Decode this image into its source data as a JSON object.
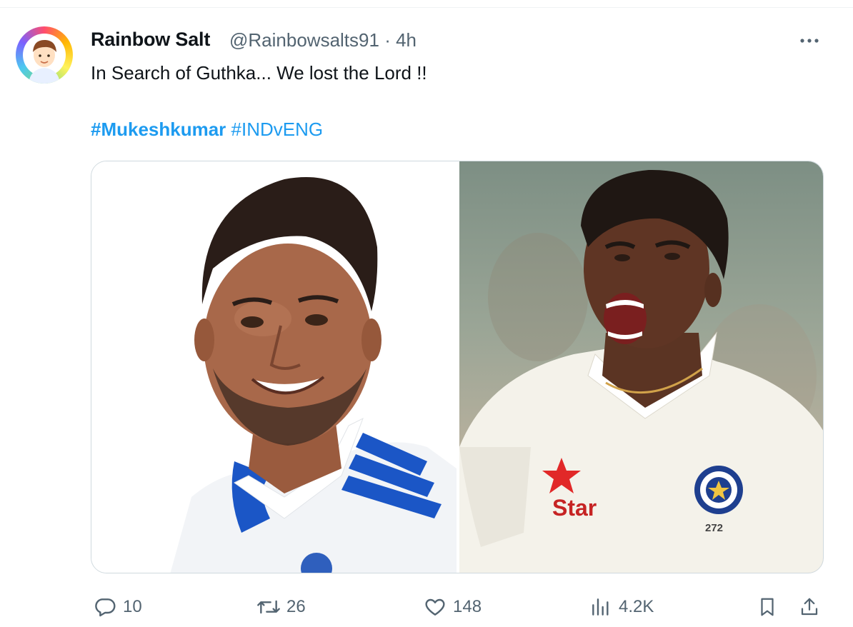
{
  "tweet": {
    "display_name": "Rainbow Salt",
    "handle": "@Rainbowsalts91",
    "separator": "·",
    "time": "4h",
    "text": "In Search of Guthka... We lost the Lord !!",
    "hashtags": [
      "#Mukeshkumar",
      "#INDvENG"
    ]
  },
  "media": {
    "right_image": {
      "sponsor_text": "Star",
      "shirt_number": "272"
    }
  },
  "actions": {
    "reply_count": "10",
    "retweet_count": "26",
    "like_count": "148",
    "view_count": "4.2K"
  },
  "icons": {
    "reply": "speech-bubble-icon",
    "retweet": "retweet-arrows-icon",
    "like": "heart-icon",
    "views": "bar-chart-icon",
    "bookmark": "bookmark-icon",
    "share": "share-upload-icon",
    "more": "three-dots-icon"
  },
  "colors": {
    "link": "#1d9bf0",
    "muted": "#536471",
    "text": "#0f1419",
    "border": "#cfd9de"
  }
}
